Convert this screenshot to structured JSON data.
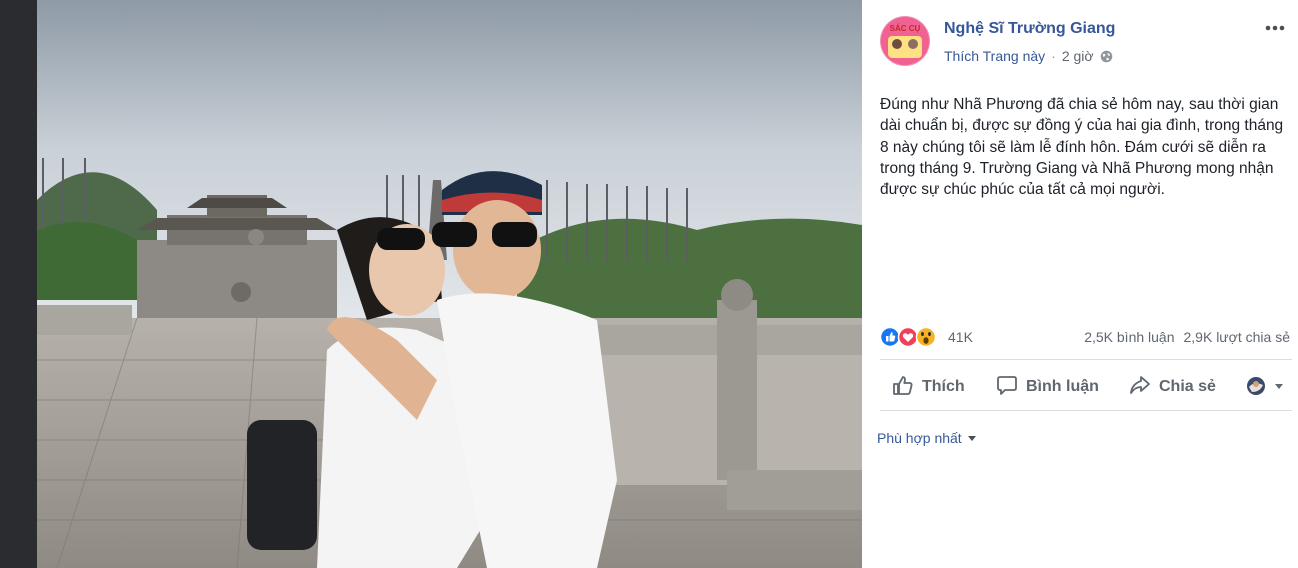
{
  "post": {
    "page_name": "Nghệ Sĩ Trường Giang",
    "like_page_label": "Thích Trang này",
    "separator": "·",
    "time": "2 giờ",
    "privacy_icon": "globe-icon",
    "more_icon": "more-dots-icon",
    "avatar_text": "SÁC CỤ",
    "text": "Đúng như Nhã Phương đã chia sẻ hôm nay, sau thời gian dài chuẩn bị, được sự đồng ý của hai gia đình, trong tháng 8 này chúng tôi sẽ làm lễ đính hôn. Đám cưới sẽ diễn ra trong tháng 9. Trường Giang và Nhã Phương mong nhận được sự chúc phúc của tất cả mọi người."
  },
  "reactions": {
    "icons": [
      "like-reaction-icon",
      "love-reaction-icon",
      "wow-reaction-icon"
    ],
    "count": "41K",
    "comments": "2,5K bình luận",
    "shares": "2,9K lượt chia sẻ"
  },
  "actions": {
    "like_label": "Thích",
    "comment_label": "Bình luận",
    "share_label": "Chia sẻ"
  },
  "comments": {
    "sort_label": "Phù hợp nhất"
  },
  "colors": {
    "link": "#365899",
    "like_blue": "#1877f2",
    "love_red": "#f33e58",
    "wow_yellow": "#f7b125",
    "text": "#1d2129",
    "muted": "#606770"
  }
}
